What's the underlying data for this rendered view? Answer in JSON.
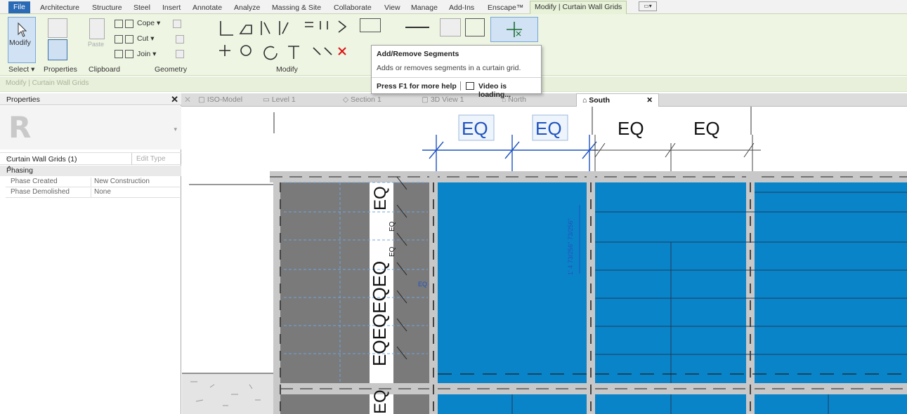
{
  "ribbon_tabs": [
    {
      "id": "file",
      "label": "File"
    },
    {
      "id": "architecture",
      "label": "Architecture"
    },
    {
      "id": "structure",
      "label": "Structure"
    },
    {
      "id": "steel",
      "label": "Steel"
    },
    {
      "id": "insert",
      "label": "Insert"
    },
    {
      "id": "annotate",
      "label": "Annotate"
    },
    {
      "id": "analyze",
      "label": "Analyze"
    },
    {
      "id": "massing",
      "label": "Massing & Site"
    },
    {
      "id": "collaborate",
      "label": "Collaborate"
    },
    {
      "id": "view",
      "label": "View"
    },
    {
      "id": "manage",
      "label": "Manage"
    },
    {
      "id": "addins",
      "label": "Add-Ins"
    },
    {
      "id": "enscape",
      "label": "Enscape™"
    },
    {
      "id": "modify_cwg",
      "label": "Modify | Curtain Wall Grids"
    }
  ],
  "ribbon": {
    "modify_label": "Modify",
    "select_label": "Select ▾",
    "properties_label": "Properties",
    "clipboard_label": "Clipboard",
    "geometry_label": "Geometry",
    "modify_group_label": "Modify",
    "paste_label": "Paste",
    "cope_label": "Cope ▾",
    "cut_label": "Cut ▾",
    "join_label": "Join ▾"
  },
  "context_bar": {
    "text": "Modify | Curtain Wall Grids"
  },
  "tooltip": {
    "title": "Add/Remove Segments",
    "description": "Adds or removes segments in a curtain grid.",
    "help": "Press F1 for more help",
    "video": "Video is loading..."
  },
  "properties": {
    "title": "Properties",
    "close": "✕",
    "logo": "R",
    "type_selector": "Curtain Wall Grids (1)",
    "edit_type": "Edit Type",
    "category": "Phasing",
    "rows": [
      {
        "key": "Phase Created",
        "value": "New Construction"
      },
      {
        "key": "Phase Demolished",
        "value": "None"
      }
    ]
  },
  "view_tabs": [
    {
      "id": "iso",
      "label": "ISO-Model"
    },
    {
      "id": "level1",
      "label": "Level 1"
    },
    {
      "id": "section1",
      "label": "Section 1"
    },
    {
      "id": "3d",
      "label": "3D View 1"
    },
    {
      "id": "north",
      "label": "North"
    },
    {
      "id": "south",
      "label": "South",
      "active": true
    }
  ],
  "view_tab_close": "✕",
  "canvas": {
    "dim_label": "EQ",
    "vertical_dim_text": "EQEQEQEQ",
    "small_eq": "EQ",
    "vertical_blue_dim": "1' 4 73/256\" 73/256\"",
    "colors": {
      "panel": "#0a84c8",
      "mullion": "#c8c8c8",
      "wall": "#7a7a7a",
      "dim_blue": "#1f53c0"
    }
  }
}
